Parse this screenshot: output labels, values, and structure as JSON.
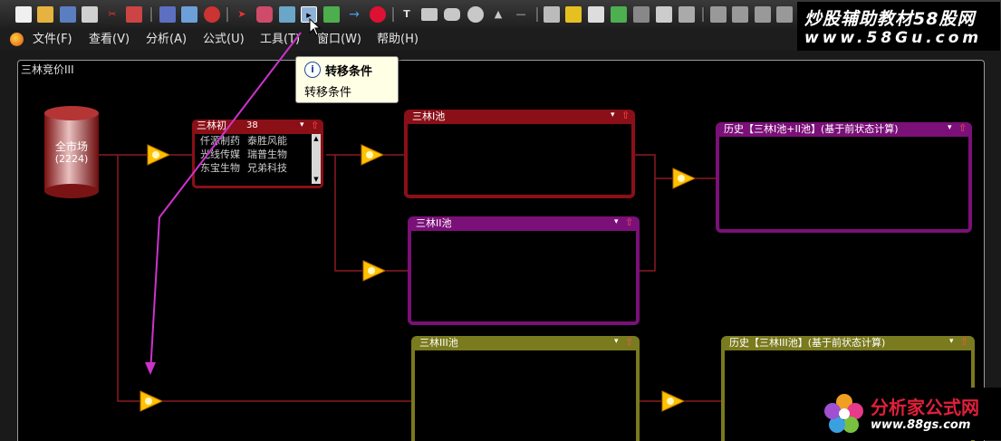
{
  "menubar": {
    "items": [
      "文件(F)",
      "查看(V)",
      "分析(A)",
      "公式(U)",
      "工具(T)",
      "窗口(W)",
      "帮助(H)"
    ]
  },
  "window": {
    "title": "三林竞价III"
  },
  "source": {
    "label": "全市场",
    "count": "(2224)"
  },
  "stock_box": {
    "title": "三林初",
    "count": "38",
    "stocks": [
      "仟源制药",
      "泰胜风能",
      "光线传媒",
      "瑞普生物",
      "东宝生物",
      "兄弟科技"
    ]
  },
  "pools": {
    "pool1": "三林I池",
    "pool2": "三林II池",
    "pool3": "三林III池",
    "hist1": "历史【三林I池+II池】(基于前状态计算)",
    "hist2": "历史【三林III池】(基于前状态计算)"
  },
  "tooltip": {
    "title": "转移条件",
    "text": "转移条件",
    "icon": "info-icon"
  },
  "watermark_top": {
    "line1": "炒股辅助教材58股网",
    "line2": "www.58Gu.com"
  },
  "watermark_bottom": {
    "line1": "分析家公式网",
    "line2": "www.88gs.com"
  },
  "colors": {
    "pool1": "#8b0f17",
    "pool2": "#7b1079",
    "pool3": "#7a7a1e",
    "hist1": "#7b1079",
    "hist2": "#7a7a1e",
    "stock_box": "#8b0f17",
    "connector": "#8b1a22",
    "pointer_arrow": "#cc33cc",
    "filter_fill": "#ffc200"
  }
}
